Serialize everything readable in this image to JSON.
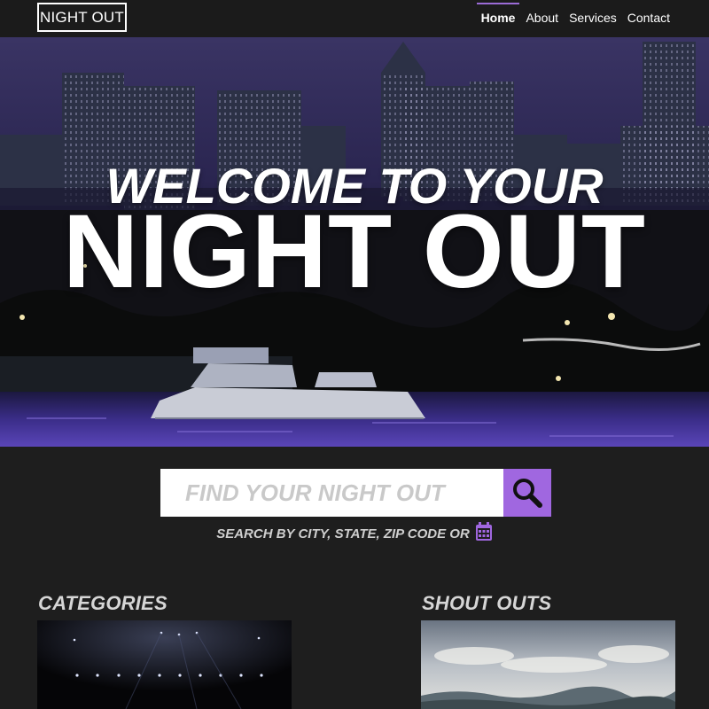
{
  "nav": {
    "logo": "NIGHT OUT",
    "links": [
      {
        "label": "Home",
        "active": true
      },
      {
        "label": "About"
      },
      {
        "label": "Services"
      },
      {
        "label": "Contact"
      }
    ]
  },
  "hero": {
    "subtitle": "WELCOME TO YOUR",
    "title": "NIGHT OUT"
  },
  "search": {
    "placeholder": "FIND YOUR NIGHT OUT",
    "button_icon": "search-icon",
    "hint": "SEARCH BY CITY, STATE, ZIP CODE OR",
    "hint_icon": "calendar-icon"
  },
  "sections": {
    "categories": {
      "title": "CATEGORIES"
    },
    "shoutouts": {
      "title": "SHOUT OUTS"
    }
  },
  "colors": {
    "accent": "#a067e0",
    "background": "#1e1e1e",
    "navbar": "#1b1b1b"
  }
}
